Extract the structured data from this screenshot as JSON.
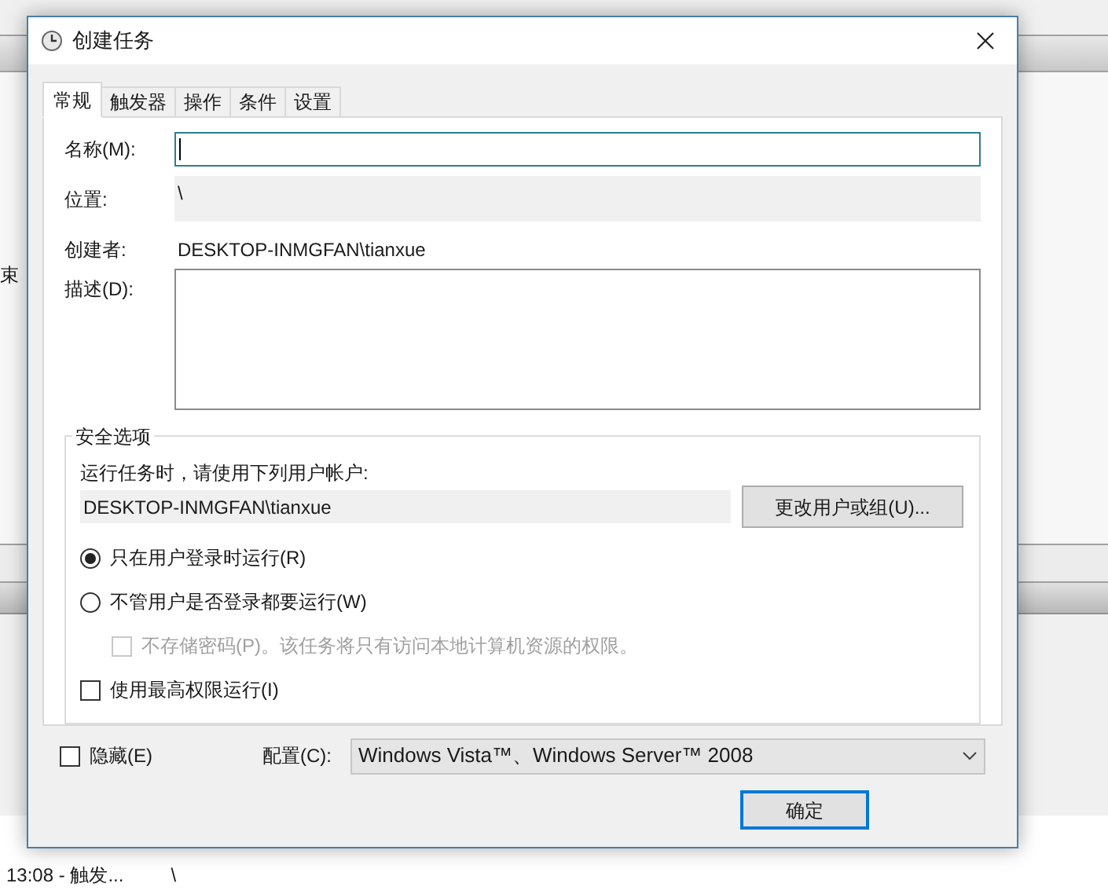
{
  "background": {
    "side_text": "束",
    "status_row": {
      "time": "13:08 - 触发...",
      "column_2": "\\"
    }
  },
  "dialog": {
    "title": "创建任务",
    "tabs": [
      {
        "label": "常规",
        "selected": true
      },
      {
        "label": "触发器",
        "selected": false
      },
      {
        "label": "操作",
        "selected": false
      },
      {
        "label": "条件",
        "selected": false
      },
      {
        "label": "设置",
        "selected": false
      }
    ],
    "general": {
      "name": {
        "label": "名称(M):"
      },
      "location": {
        "label": "位置:",
        "value": "\\"
      },
      "author": {
        "label": "创建者:",
        "value": "DESKTOP-INMGFAN\\tianxue"
      },
      "description": {
        "label": "描述(D):"
      },
      "security": {
        "title": "安全选项",
        "prompt": "运行任务时，请使用下列用户帐户:",
        "account": "DESKTOP-INMGFAN\\tianxue",
        "change_button": "更改用户或组(U)...",
        "options": [
          {
            "kind": "radio",
            "label": "只在用户登录时运行(R)",
            "selected": true
          },
          {
            "kind": "radio",
            "label": "不管用户是否登录都要运行(W)",
            "selected": false,
            "children": [
              {
                "kind": "checkbox",
                "label": "不存储密码(P)。该任务将只有访问本地计算机资源的权限。",
                "checked": false,
                "disabled": true
              }
            ]
          },
          {
            "kind": "checkbox",
            "label": "使用最高权限运行(I)",
            "checked": false,
            "disabled": false
          }
        ]
      }
    },
    "hidden": {
      "label": "隐藏(E)",
      "checked": false
    },
    "configure": {
      "label": "配置(C):",
      "value": "Windows Vista™、Windows Server™ 2008"
    },
    "buttons": [
      "确定"
    ]
  }
}
